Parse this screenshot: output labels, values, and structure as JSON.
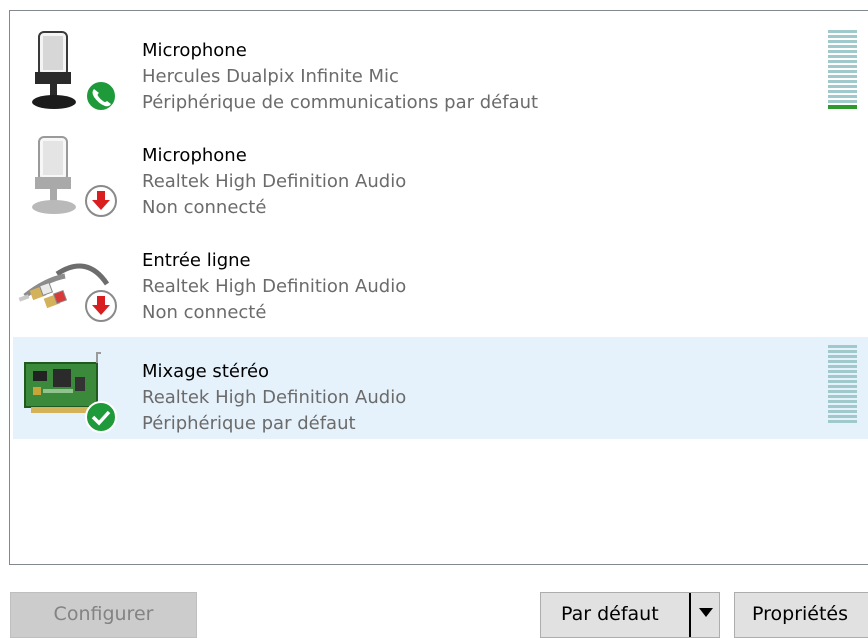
{
  "devices": [
    {
      "name": "Microphone",
      "model": "Hercules Dualpix Infinite Mic",
      "status": "Périphérique de communications par défaut",
      "icon": "microphone-icon",
      "badge": "phone-badge-icon",
      "level_fraction": 0.06,
      "selected": false
    },
    {
      "name": "Microphone",
      "model": "Realtek High Definition Audio",
      "status": "Non connecté",
      "icon": "microphone-icon",
      "badge": "disconnected-badge-icon",
      "selected": false
    },
    {
      "name": "Entrée ligne",
      "model": "Realtek High Definition Audio",
      "status": "Non connecté",
      "icon": "line-in-cable-icon",
      "badge": "disconnected-badge-icon",
      "selected": false
    },
    {
      "name": "Mixage stéréo",
      "model": "Realtek High Definition Audio",
      "status": "Périphérique par défaut",
      "icon": "sound-card-icon",
      "badge": "default-check-badge-icon",
      "level_fraction": 0,
      "selected": true
    }
  ],
  "buttons": {
    "configure": "Configurer",
    "set_default": "Par défaut",
    "properties": "Propriétés"
  },
  "colors": {
    "selection": "#e5f1fb",
    "meter_level": "#2e9a2e",
    "meter_empty": "#9fc9cb",
    "badge_green": "#1e9a3a",
    "badge_red": "#d81e1e"
  }
}
